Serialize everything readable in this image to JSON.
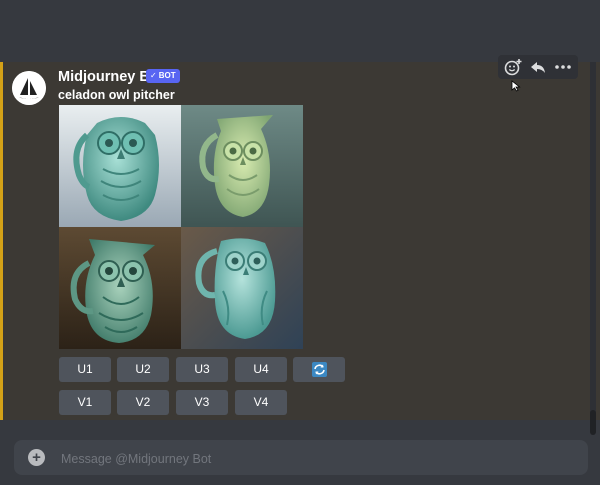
{
  "message": {
    "author": "Midjourney Bot",
    "bot_tag": {
      "check": "✓",
      "label": "BOT"
    },
    "prompt": "celadon owl pitcher"
  },
  "toolbar": {
    "icons": [
      "add-reaction-icon",
      "reply-icon",
      "more-options-icon"
    ]
  },
  "image_grid": {
    "alt": "celadon owl pitcher",
    "tiles": [
      "celadon-owl-pitcher-1",
      "celadon-owl-pitcher-2",
      "celadon-owl-pitcher-3",
      "celadon-owl-pitcher-4"
    ]
  },
  "buttons": {
    "upscale": [
      "U1",
      "U2",
      "U3",
      "U4"
    ],
    "variation": [
      "V1",
      "V2",
      "V3",
      "V4"
    ],
    "refresh_icon": "refresh-icon"
  },
  "composer": {
    "placeholder": "Message @Midjourney Bot"
  },
  "colors": {
    "accent": "#d4a117",
    "blurple": "#5865f2",
    "button": "#4f545c",
    "background": "#36393f"
  }
}
